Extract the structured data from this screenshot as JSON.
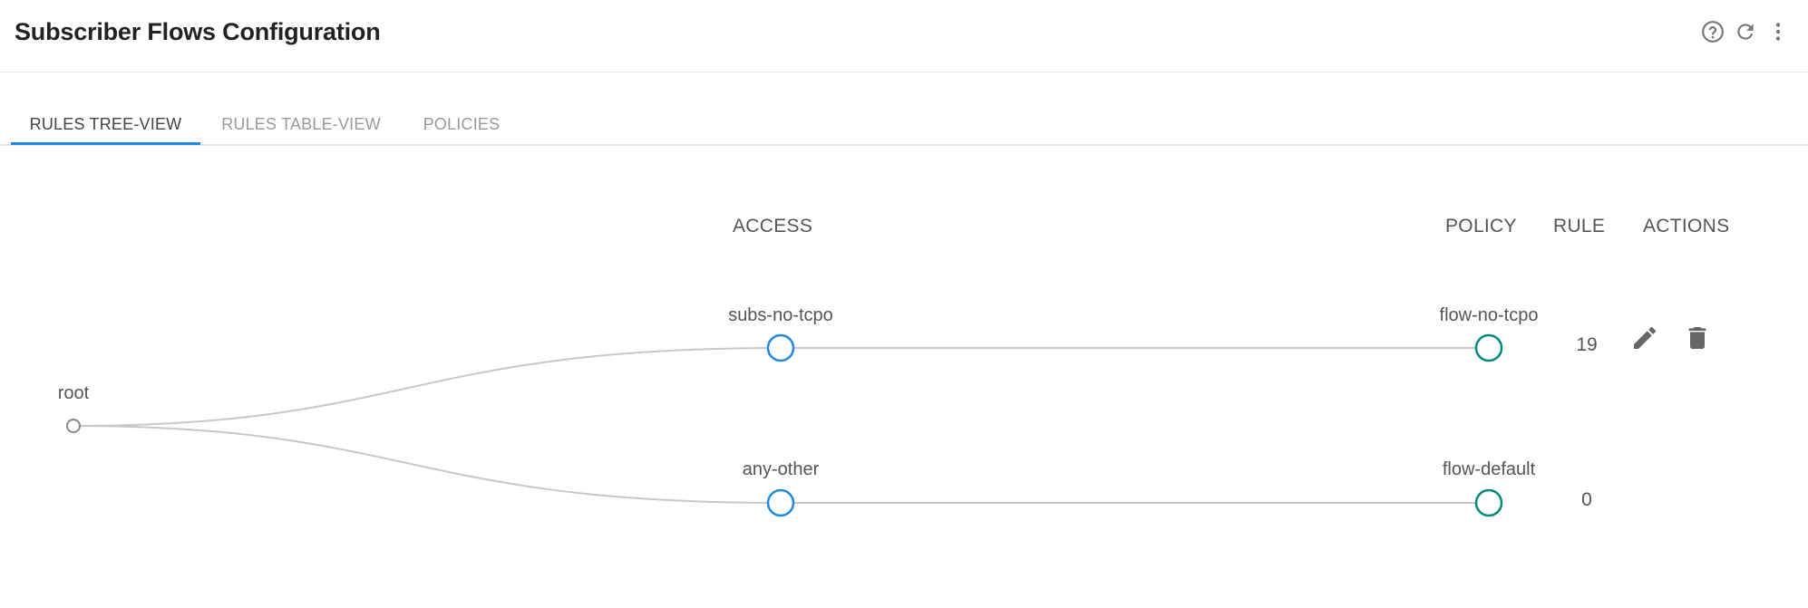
{
  "header": {
    "title": "Subscriber Flows Configuration",
    "icons": [
      "help-icon",
      "refresh-icon",
      "more-vert-icon"
    ]
  },
  "tabs": [
    {
      "label": "RULES TREE-VIEW",
      "active": true
    },
    {
      "label": "RULES TABLE-VIEW",
      "active": false
    },
    {
      "label": "POLICIES",
      "active": false
    }
  ],
  "columns": {
    "access": "ACCESS",
    "policy": "POLICY",
    "rule": "RULE",
    "actions": "ACTIONS"
  },
  "tree": {
    "root": "root",
    "rows": [
      {
        "access": "subs-no-tcpo",
        "policy": "flow-no-tcpo",
        "rule": "19",
        "has_actions": true
      },
      {
        "access": "any-other",
        "policy": "flow-default",
        "rule": "0",
        "has_actions": false
      }
    ]
  },
  "colors": {
    "accent": "#1e88e5",
    "access_node": "#1e88e5",
    "policy_node": "#00897b",
    "link": "#c8c8c8"
  }
}
